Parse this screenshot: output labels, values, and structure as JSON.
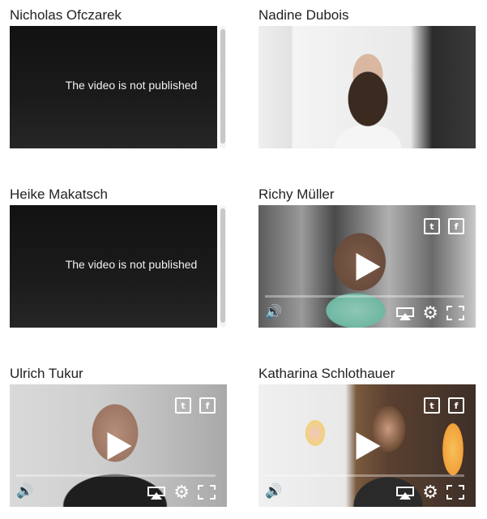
{
  "cards": [
    {
      "name": "Nicholas Ofczarek",
      "status": "The video is not published"
    },
    {
      "name": "Nadine Dubois"
    },
    {
      "name": "Heike Makatsch",
      "status": "The video is not published"
    },
    {
      "name": "Richy Müller"
    },
    {
      "name": "Ulrich Tukur"
    },
    {
      "name": "Katharina Schlothauer"
    }
  ],
  "icons": {
    "twitter": "twitter-icon",
    "facebook": "facebook-icon",
    "play": "play-icon",
    "volume": "volume-icon",
    "airplay": "airplay-icon",
    "settings": "gear-icon",
    "fullscreen": "fullscreen-icon"
  }
}
